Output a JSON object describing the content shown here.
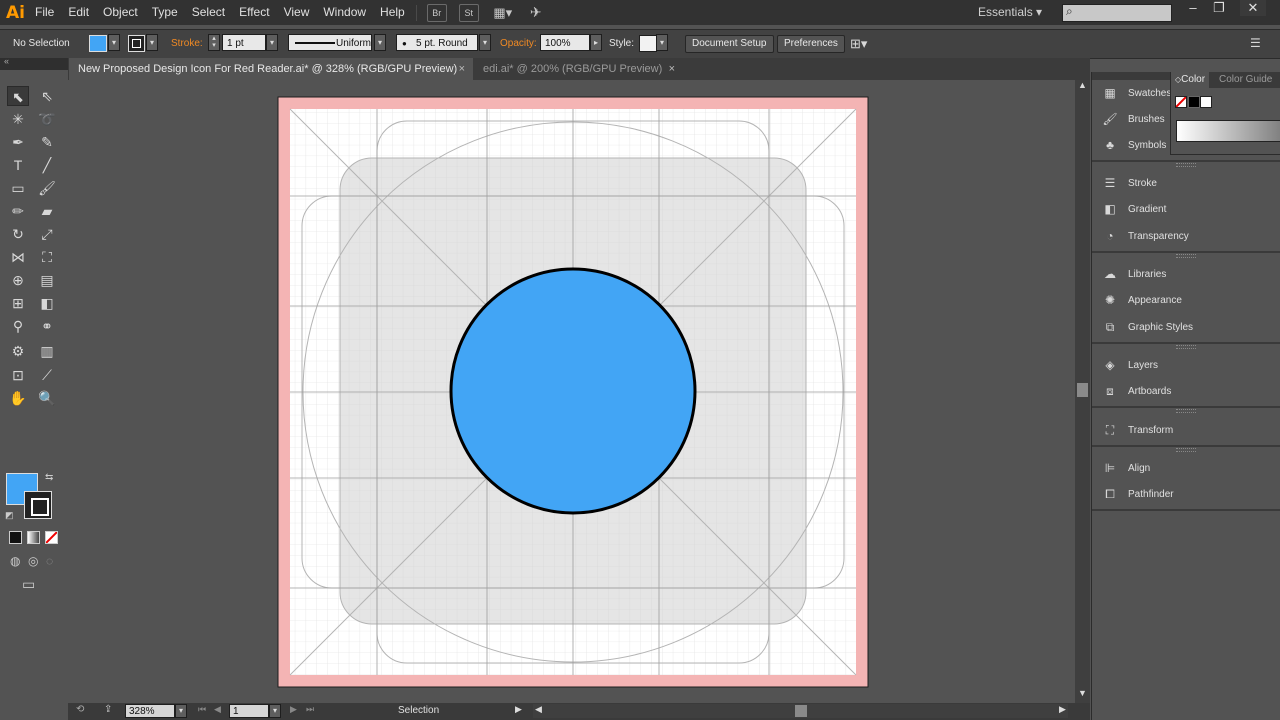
{
  "app": {
    "logo": "Ai",
    "menu": [
      "File",
      "Edit",
      "Object",
      "Type",
      "Select",
      "Effect",
      "View",
      "Window",
      "Help"
    ],
    "bridge_label": "Br",
    "stock_label": "St",
    "workspace": "Essentials",
    "search_placeholder": ""
  },
  "control_bar": {
    "selection_label": "No Selection",
    "stroke_label": "Stroke:",
    "stroke_weight": "1 pt",
    "stroke_profile": "Uniform",
    "brush": "5 pt. Round",
    "opacity_label": "Opacity:",
    "opacity_value": "100%",
    "style_label": "Style:",
    "document_setup": "Document Setup",
    "preferences": "Preferences"
  },
  "tabs": [
    {
      "label": "New Proposed Design Icon For Red Reader.ai* @ 328% (RGB/GPU Preview)",
      "close": "×",
      "active": true
    },
    {
      "label": "edi.ai* @ 200% (RGB/GPU Preview)",
      "close": "×",
      "active": false
    }
  ],
  "status_bar": {
    "zoom": "328%",
    "artboard": "1",
    "tool": "Selection"
  },
  "dock": {
    "groups": [
      [
        {
          "label": "Swatches",
          "icon": "swatches-icon"
        },
        {
          "label": "Brushes",
          "icon": "brushes-icon"
        },
        {
          "label": "Symbols",
          "icon": "symbols-icon"
        }
      ],
      [
        {
          "label": "Stroke",
          "icon": "stroke-icon"
        },
        {
          "label": "Gradient",
          "icon": "gradient-icon"
        },
        {
          "label": "Transparency",
          "icon": "transparency-icon"
        }
      ],
      [
        {
          "label": "Libraries",
          "icon": "libraries-icon"
        },
        {
          "label": "Appearance",
          "icon": "appearance-icon"
        },
        {
          "label": "Graphic Styles",
          "icon": "graphic-styles-icon"
        }
      ],
      [
        {
          "label": "Layers",
          "icon": "layers-icon"
        },
        {
          "label": "Artboards",
          "icon": "artboards-icon"
        }
      ],
      [
        {
          "label": "Transform",
          "icon": "transform-icon"
        }
      ],
      [
        {
          "label": "Align",
          "icon": "align-icon"
        },
        {
          "label": "Pathfinder",
          "icon": "pathfinder-icon"
        }
      ]
    ]
  },
  "color_panel": {
    "tabs": [
      "Color",
      "Color Guide"
    ]
  },
  "colors": {
    "fill": "#42a5f5",
    "stroke": "#000000",
    "bleed": "#f4b4b4",
    "accent_orange": "#f08a24"
  }
}
